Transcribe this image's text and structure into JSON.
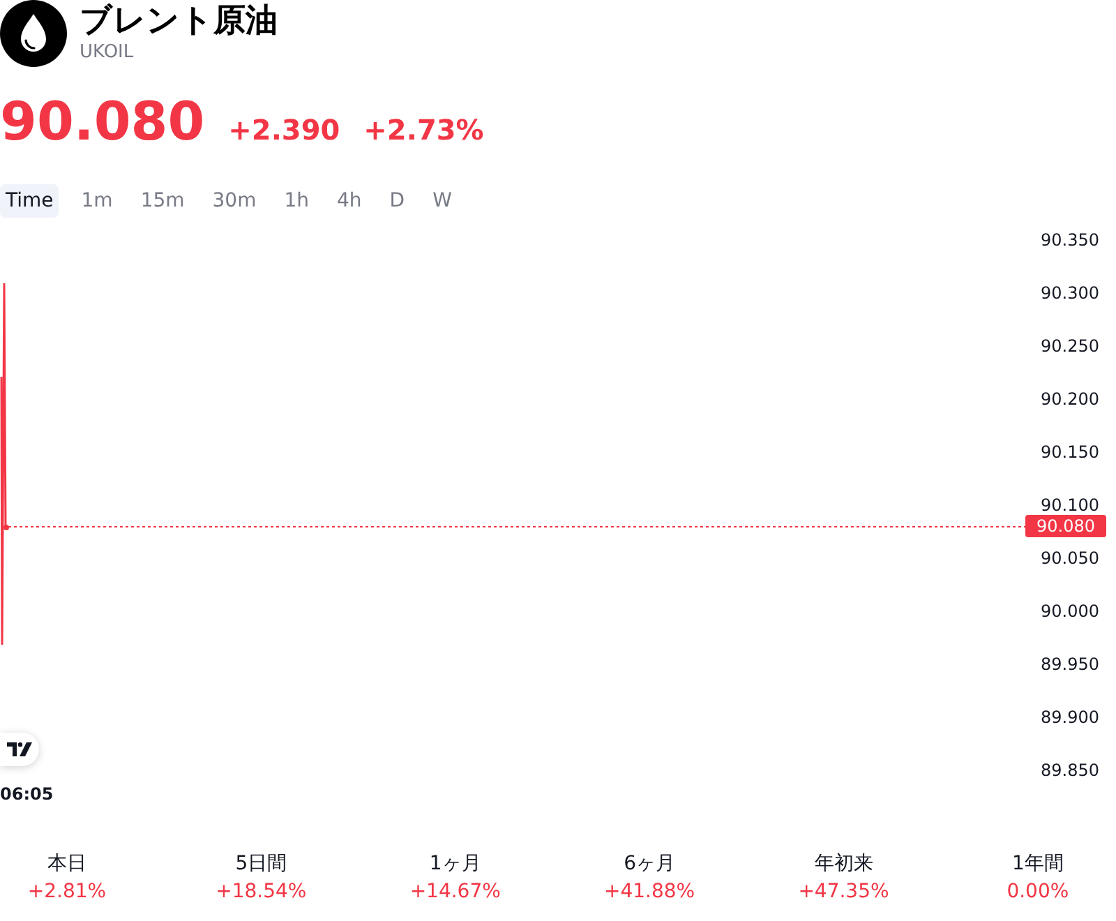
{
  "header": {
    "title": "ブレント原油",
    "symbol": "UKOIL"
  },
  "quote": {
    "price": "90.080",
    "change": "+2.390",
    "change_percent": "+2.73%"
  },
  "intervals": [
    {
      "label": "Time",
      "selected": true
    },
    {
      "label": "1m",
      "selected": false
    },
    {
      "label": "15m",
      "selected": false
    },
    {
      "label": "30m",
      "selected": false
    },
    {
      "label": "1h",
      "selected": false
    },
    {
      "label": "4h",
      "selected": false
    },
    {
      "label": "D",
      "selected": false
    },
    {
      "label": "W",
      "selected": false
    }
  ],
  "chart": {
    "price_axis_labels": [
      "90.350",
      "90.300",
      "90.250",
      "90.200",
      "90.150",
      "90.100",
      "90.050",
      "90.000",
      "89.950",
      "89.900",
      "89.850"
    ],
    "last_price_tag": "90.080",
    "time_label": "06:05"
  },
  "performance": [
    {
      "period": "本日",
      "change": "+2.81%"
    },
    {
      "period": "5日間",
      "change": "+18.54%"
    },
    {
      "period": "1ヶ月",
      "change": "+14.67%"
    },
    {
      "period": "6ヶ月",
      "change": "+41.88%"
    },
    {
      "period": "年初来",
      "change": "+47.35%"
    },
    {
      "period": "1年間",
      "change": "0.00%"
    }
  ]
}
